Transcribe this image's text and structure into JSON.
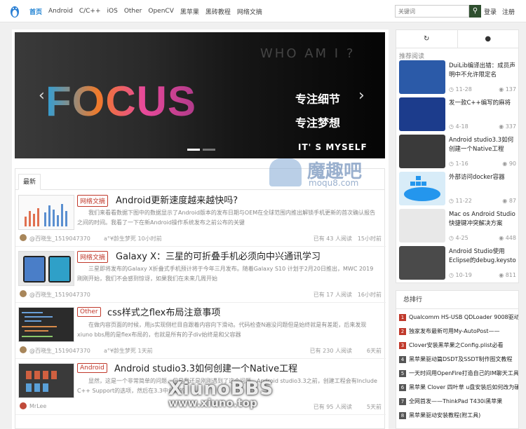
{
  "nav": {
    "items": [
      "首页",
      "Android",
      "C/C++",
      "iOS",
      "Other",
      "OpenCV",
      "黑苹果",
      "黑砖教程",
      "网络文摘"
    ],
    "search_placeholder": "关键词",
    "login": "登录",
    "register": "注册"
  },
  "banner": {
    "focus": "FOCUS",
    "who": "WHO AM I ?",
    "line1": "专注细节",
    "line2": "专注梦想",
    "its": "IT' S MYSELF"
  },
  "feed": {
    "tab": "最新",
    "posts": [
      {
        "tag": "网络文摘",
        "title": "Android更新速度越来越快吗?",
        "excerpt": "我们来看看数据下图中的数据显示了Android版本的发布日期与OEM在全球范围内推出解锁手机更新的首次确认报告之间的时间。我看了一下在新Android操作系统发布之前公布的关键",
        "author": "@百晓生_1519047370",
        "time": "a°¥龄生梦死  10小时前",
        "views": "43",
        "views_label": "已有 43 人阅读",
        "ago": "15小时前"
      },
      {
        "tag": "网络文摘",
        "title": "Galaxy X：三星的可折叠手机必须向中兴通讯学习",
        "excerpt": "三星即将发布的Galaxy X折叠式手机预计将于今年三月发布。随着Galaxy S10 计划于2月20日推出，MWC 2019刚刚开始，我们不会感到惊讶，如果我们在未来几周开始",
        "author": "@百晓生_1519047370",
        "time": "",
        "views": "17",
        "views_label": "已有 17 人阅读",
        "ago": "16小时前"
      },
      {
        "tag": "Other",
        "title": "css样式之flex布局注意事项",
        "excerpt": "在做内容页面的时候，用js实现侧栏目自跟着内容向下滑动。代码检查N遍没问题但是始终就是有差距，后来发现xiuno bbs用的是flex布局的，也就是所有的子div始终是和父容器",
        "author": "@百晓生_1519047370",
        "time": "a°¥龄生梦死  1天前",
        "views": "230",
        "views_label": "已有 230 人阅读",
        "ago": "6天前"
      },
      {
        "tag": "Android",
        "title": "Android studio3.3如何创建一个Native工程",
        "excerpt": "显然，这是一个非常简单的问题，但是我还是刚刚遇到了这个问题。Android studio3.3之前，创建工程会有Include C++ Support的选项，然后在3.3中创建的",
        "author": "MrLee",
        "time": "",
        "views": "95",
        "views_label": "已有 95 人阅读",
        "ago": "5天前"
      }
    ]
  },
  "sidebar": {
    "tab1_icon": "refresh-icon",
    "tab2_icon": "comment-icon",
    "heading": "推荐阅读",
    "items": [
      {
        "title": "DuiLib编译出错：成员声明中不允许限定名",
        "date": "11-28",
        "views": "137"
      },
      {
        "title": "发一款C++编写的麻将",
        "date": "4-18",
        "views": "337"
      },
      {
        "title": "Android studio3.3如何创建一个Native工程",
        "date": "1-16",
        "views": "90"
      },
      {
        "title": "外部访问docker容器",
        "date": "11-22",
        "views": "87"
      },
      {
        "title": "Mac os Android Studio 快捷键冲突解决方案",
        "date": "4-25",
        "views": "448"
      },
      {
        "title": "Android Studio使用Eclipse的debug.keysto",
        "date": "10-19",
        "views": "811"
      }
    ]
  },
  "rank": {
    "heading": "总排行",
    "items": [
      "Qualcomm HS-USB QDLoader 9008驱动程",
      "独家发布最新可用My-AutoPost——",
      "Clover安装黑苹果之Config.plist必看",
      "黑苹果驱动篇DSDT及SSDT制作图文教程",
      "一天时间用OpenFire打造自己的IM聊天工具",
      "黑苹果 Clover 四叶草 u盘安装后如何改为硬",
      "全网首发——ThinkPad T430i黑苹果",
      "黑苹果驱动安装教程(附工具)"
    ]
  },
  "watermarks": {
    "moqu_cn": "魔趣吧",
    "moqu_en": "moqu8.com",
    "xiuno": "XiunoBBS",
    "xiuno_url": "www.xiuno.top"
  },
  "colors": {
    "accent": "#1a7fd1",
    "tag": "#c0392b",
    "search_btn": "#2f4f2f"
  }
}
